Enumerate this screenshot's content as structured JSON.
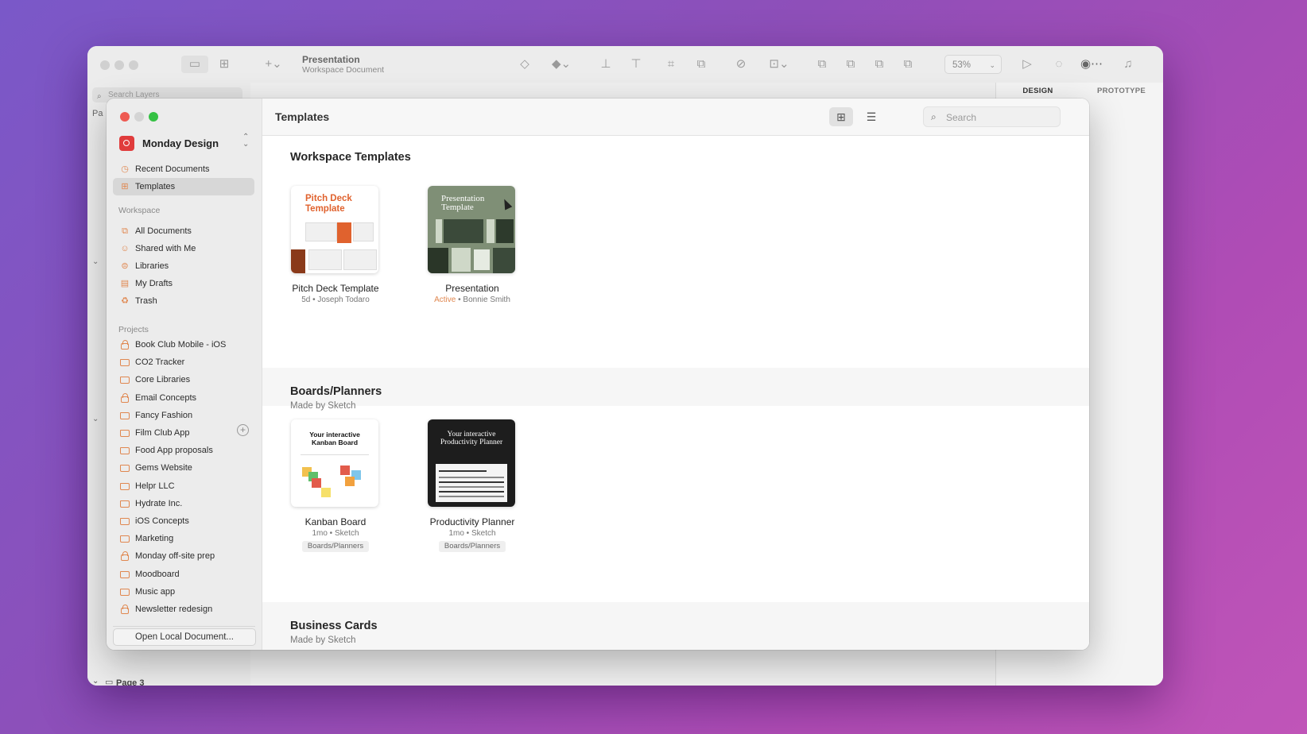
{
  "background_app": {
    "document_title": "Presentation",
    "document_subtitle": "Workspace Document",
    "zoom": "53%",
    "search_layers_placeholder": "Search Layers",
    "inspector_tabs": [
      "DESIGN",
      "PROTOTYPE"
    ],
    "page_label": "Page 3",
    "page_prefix": "Pa"
  },
  "modal": {
    "workspace_name": "Monday Design",
    "top_nav": [
      {
        "label": "Recent Documents",
        "icon": "clock-icon",
        "selected": false
      },
      {
        "label": "Templates",
        "icon": "templates-icon",
        "selected": true
      }
    ],
    "workspace_section": "Workspace",
    "workspace_nav": [
      {
        "label": "All Documents",
        "icon": "documents-icon"
      },
      {
        "label": "Shared with Me",
        "icon": "person-icon"
      },
      {
        "label": "Libraries",
        "icon": "library-icon"
      },
      {
        "label": "My Drafts",
        "icon": "drafts-icon"
      },
      {
        "label": "Trash",
        "icon": "trash-icon"
      }
    ],
    "projects_section": "Projects",
    "projects": [
      {
        "label": "Book Club Mobile - iOS",
        "locked": true
      },
      {
        "label": "CO2 Tracker",
        "locked": false
      },
      {
        "label": "Core Libraries",
        "locked": false
      },
      {
        "label": "Email Concepts",
        "locked": true
      },
      {
        "label": "Fancy Fashion",
        "locked": false
      },
      {
        "label": "Film Club App",
        "locked": false
      },
      {
        "label": "Food App proposals",
        "locked": false
      },
      {
        "label": "Gems Website",
        "locked": false
      },
      {
        "label": "Helpr LLC",
        "locked": false
      },
      {
        "label": "Hydrate Inc.",
        "locked": false
      },
      {
        "label": "iOS Concepts",
        "locked": false
      },
      {
        "label": "Marketing",
        "locked": false
      },
      {
        "label": "Monday off-site prep",
        "locked": true
      },
      {
        "label": "Moodboard",
        "locked": false
      },
      {
        "label": "Music app",
        "locked": false
      },
      {
        "label": "Newsletter redesign",
        "locked": true
      }
    ],
    "open_local_label": "Open Local Document...",
    "main_title": "Templates",
    "search_placeholder": "Search",
    "sections": [
      {
        "title": "Workspace Templates",
        "subtitle": "",
        "cards": [
          {
            "name": "Pitch Deck Template",
            "meta": "5d • Joseph Todaro",
            "thumb_title": "Pitch Deck Template"
          },
          {
            "name": "Presentation",
            "meta_status": "Active",
            "meta": " • Bonnie Smith",
            "thumb_title": "Presentation Template"
          }
        ]
      },
      {
        "title": "Boards/Planners",
        "subtitle": "Made by Sketch",
        "cards": [
          {
            "name": "Kanban Board",
            "meta": "1mo • Sketch",
            "tag": "Boards/Planners",
            "thumb_title": "Your interactive Kanban Board"
          },
          {
            "name": "Productivity Planner",
            "meta": "1mo • Sketch",
            "tag": "Boards/Planners",
            "thumb_title": "Your interactive Productivity Planner"
          }
        ]
      },
      {
        "title": "Business Cards",
        "subtitle": "Made by Sketch",
        "cards": []
      }
    ]
  },
  "colors": {
    "accent": "#e0874f",
    "brand_red": "#e03c3c"
  }
}
